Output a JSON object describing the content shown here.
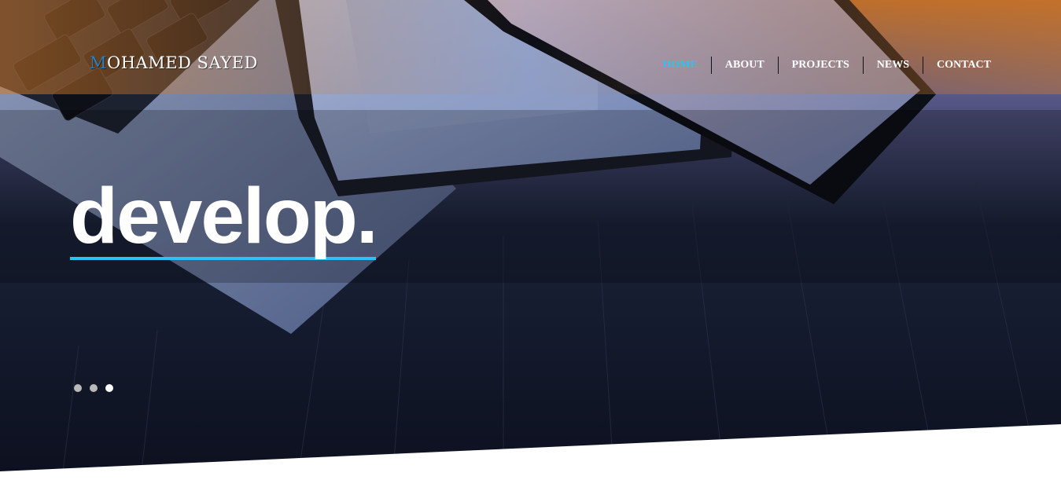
{
  "brand": {
    "initial": "M",
    "rest": "OHAMED SAYED",
    "initial_color": "#2c7fc1"
  },
  "nav": {
    "items": [
      {
        "label": "HOME",
        "active": true
      },
      {
        "label": "ABOUT",
        "active": false
      },
      {
        "label": "PROJECTS",
        "active": false
      },
      {
        "label": "NEWS",
        "active": false
      },
      {
        "label": "CONTACT",
        "active": false
      }
    ],
    "active_color": "#2ac3f4"
  },
  "hero": {
    "headline": "develop.",
    "accent_color": "#2ac3f4",
    "slides": {
      "count": 3,
      "active_index": 2
    }
  }
}
